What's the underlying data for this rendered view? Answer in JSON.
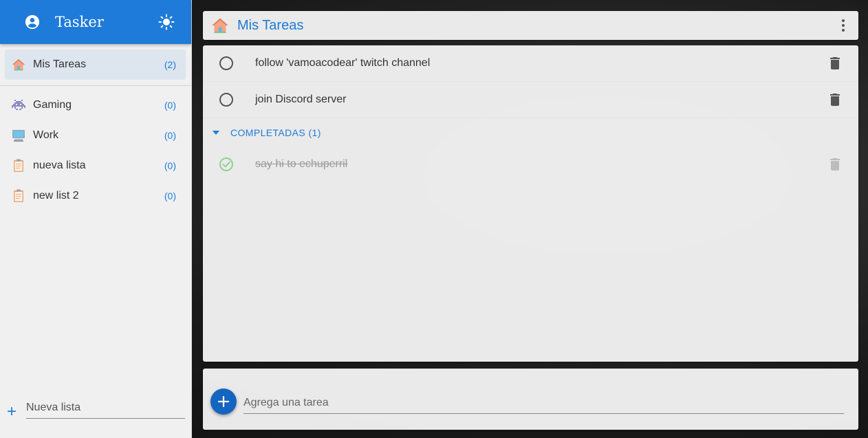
{
  "app": {
    "title": "Tasker"
  },
  "sidebar": {
    "active_list": {
      "label": "Mis Tareas",
      "count": "(2)",
      "icon": "home-icon"
    },
    "lists": [
      {
        "label": "Gaming",
        "count": "(0)",
        "icon": "space-invader-icon"
      },
      {
        "label": "Work",
        "count": "(0)",
        "icon": "computer-icon"
      },
      {
        "label": "nueva lista",
        "count": "(0)",
        "icon": "clipboard-icon"
      },
      {
        "label": "new list 2",
        "count": "(0)",
        "icon": "clipboard-icon"
      }
    ],
    "new_list_placeholder": "Nueva lista"
  },
  "main": {
    "title": "Mis Tareas",
    "tasks": [
      {
        "text": "follow 'vamoacodear' twitch channel",
        "done": false
      },
      {
        "text": "join Discord server",
        "done": false
      }
    ],
    "completed_label": "COMPLETADAS (1)",
    "completed_tasks": [
      {
        "text": "say hi to echuperril",
        "done": true
      }
    ],
    "add_placeholder": "Agrega una tarea"
  },
  "colors": {
    "primary": "#1e7bd9",
    "fab": "#1565c0",
    "done_check": "#66bb6a"
  }
}
